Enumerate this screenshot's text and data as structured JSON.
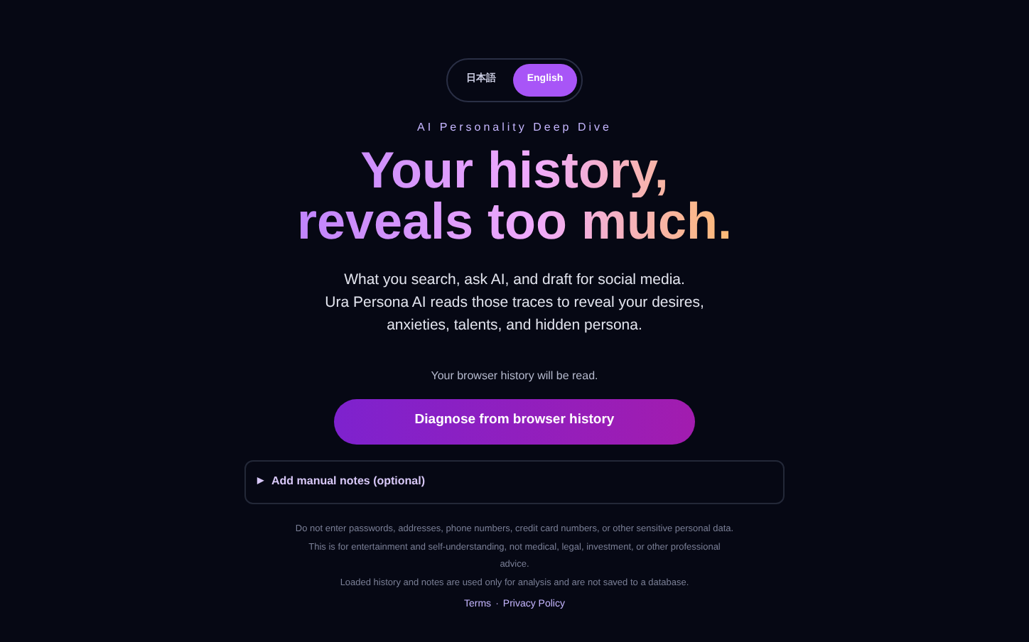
{
  "language_toggle": [
    {
      "label": "日本語",
      "selected": false
    },
    {
      "label": "English",
      "selected": true
    }
  ],
  "tagline": "AI Personality Deep Dive",
  "headline": [
    "Your history,",
    "reveals too much."
  ],
  "description": [
    "What you search, ask AI, and draft for social media.",
    "Ura Persona AI reads those traces to reveal your desires, anxieties, talents, and hidden persona."
  ],
  "history_note": "Your browser history will be read.",
  "primary_button": "Diagnose from browser history",
  "manual_notes": {
    "toggle": "▶",
    "label": "Add manual notes (optional)",
    "expanded": false
  },
  "disclaimers": [
    "Do not enter passwords, addresses, phone numbers, credit card numbers, or other sensitive personal data.",
    "This is for entertainment and self-understanding, not medical, legal, investment, or other professional advice.",
    "Loaded history and notes are used only for analysis and are not saved to a database."
  ],
  "footer_links": [
    {
      "label": "Terms"
    },
    {
      "label": "Privacy Policy"
    }
  ],
  "footer_separator": "·"
}
